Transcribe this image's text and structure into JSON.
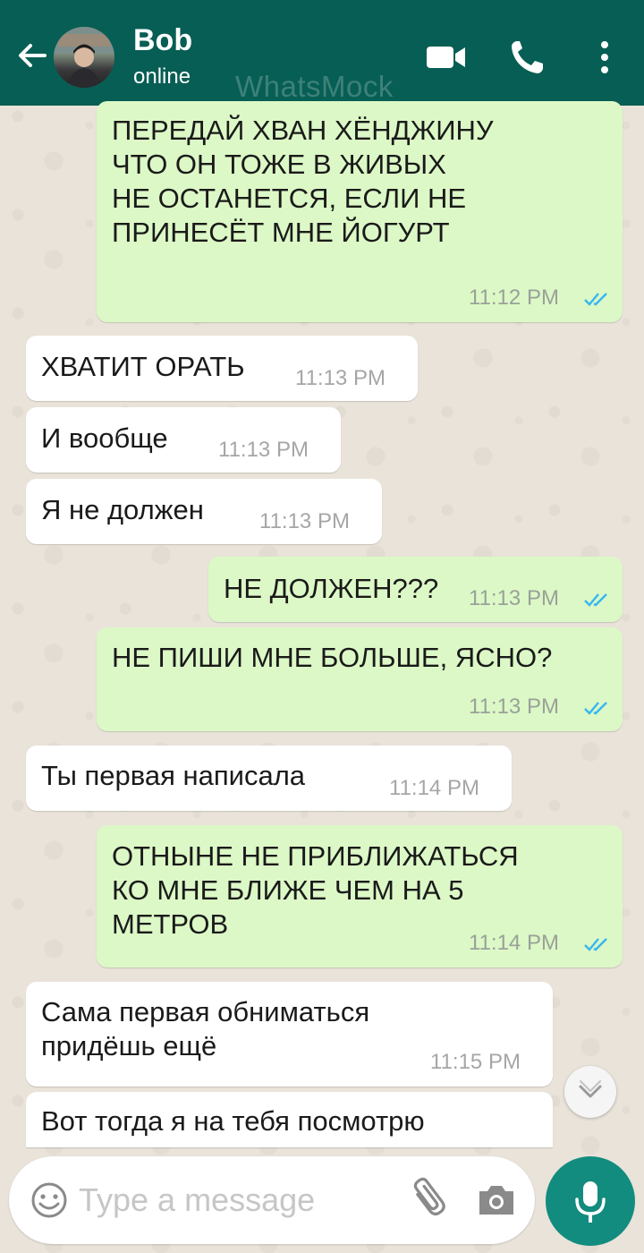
{
  "header": {
    "contact_name": "Bob",
    "status": "online",
    "watermark": "WhatsMock",
    "icons": [
      "back-arrow-icon",
      "video-call-icon",
      "phone-icon",
      "more-options-icon"
    ]
  },
  "messages": [
    {
      "direction": "outgoing",
      "text": "ПЕРЕДАЙ ХВАН ХЁНДЖИНУ\nЧТО ОН ТОЖЕ В ЖИВЫХ\nНЕ ОСТАНЕТСЯ, ЕСЛИ НЕ\nПРИНЕСЁТ МНЕ ЙОГУРТ",
      "time": "11:12 PM",
      "status": "read"
    },
    {
      "direction": "incoming",
      "text": "ХВАТИТ ОРАТЬ",
      "time": "11:13 PM"
    },
    {
      "direction": "incoming",
      "text": "И вообще",
      "time": "11:13 PM"
    },
    {
      "direction": "incoming",
      "text": "Я не должен",
      "time": "11:13 PM"
    },
    {
      "direction": "outgoing",
      "text": "НЕ ДОЛЖЕН???",
      "time": "11:13 PM",
      "status": "read"
    },
    {
      "direction": "outgoing",
      "text": "НЕ ПИШИ МНЕ БОЛЬШЕ, ЯСНО?",
      "time": "11:13 PM",
      "status": "read"
    },
    {
      "direction": "incoming",
      "text": "Ты первая написала",
      "time": "11:14 PM"
    },
    {
      "direction": "outgoing",
      "text": "ОТНЫНЕ НЕ ПРИБЛИЖАТЬСЯ\nКО МНЕ БЛИЖЕ ЧЕМ НА 5\nМЕТРОВ",
      "time": "11:14 PM",
      "status": "read"
    },
    {
      "direction": "incoming",
      "text": "Сама первая обниматься\nпридёшь ещё",
      "time": "11:15 PM"
    },
    {
      "direction": "incoming",
      "text": "Вот тогда я на тебя посмотрю",
      "time": ""
    }
  ],
  "composer": {
    "placeholder": "Type a message",
    "icons": [
      "emoji-icon",
      "attach-icon",
      "camera-icon",
      "mic-icon"
    ]
  },
  "colors": {
    "header": "#075e54",
    "outgoing_bubble": "#dcf8c6",
    "incoming_bubble": "#ffffff",
    "read_ticks": "#34b7f1",
    "mic_button": "#128c7e"
  }
}
